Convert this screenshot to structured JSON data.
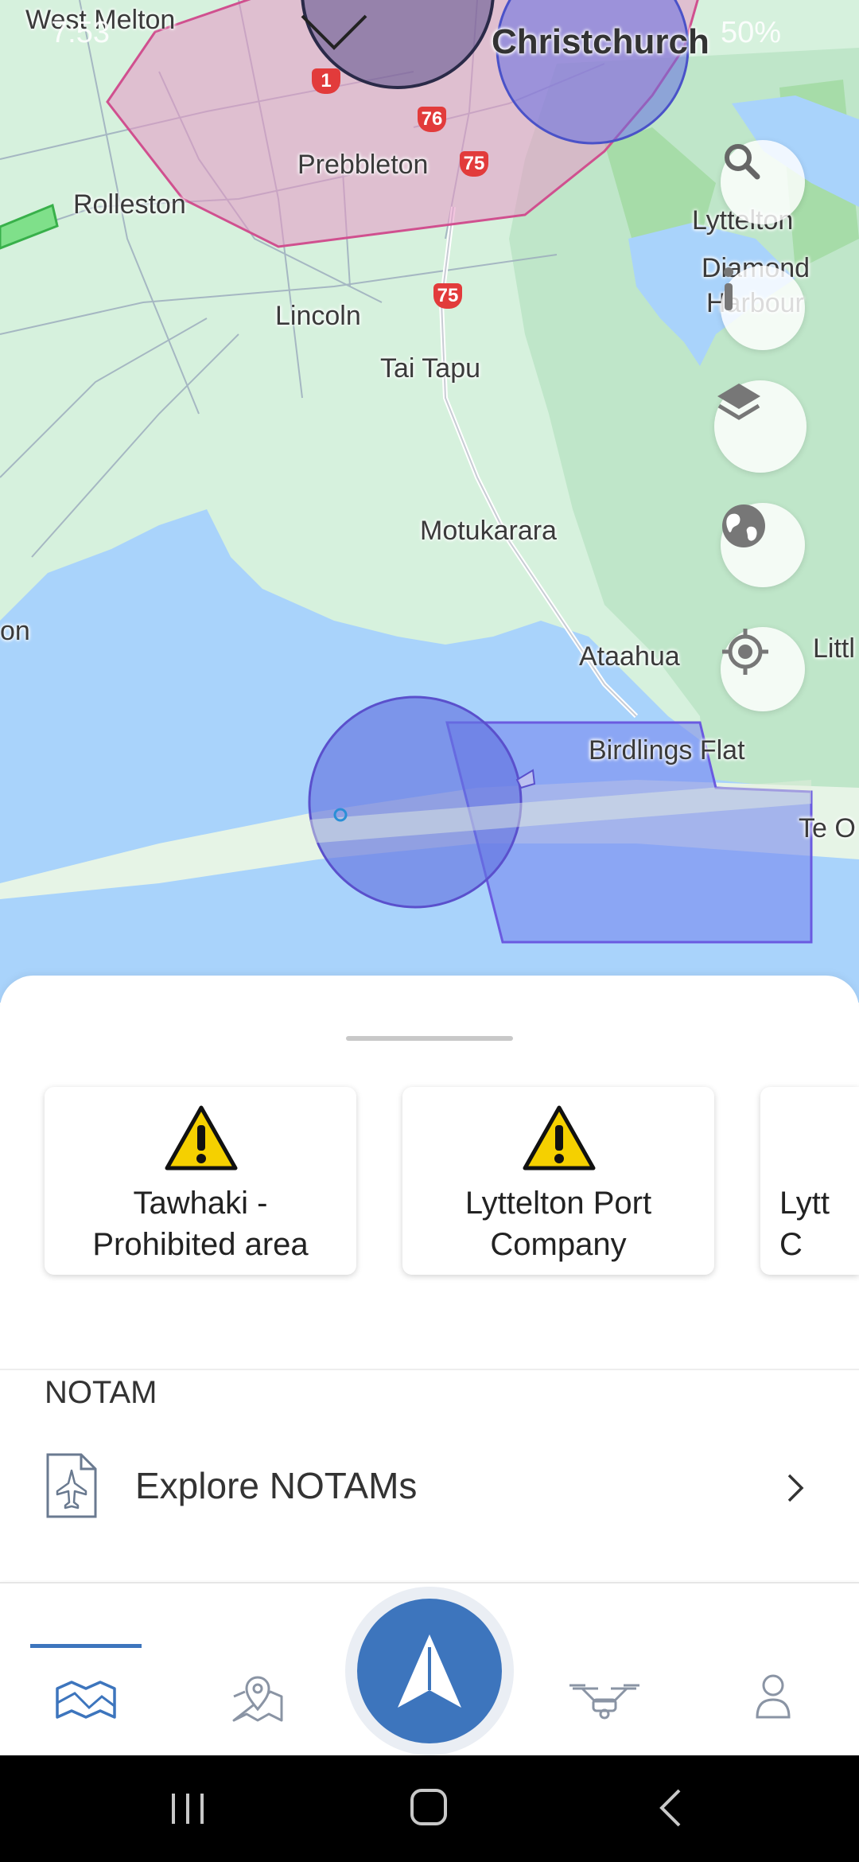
{
  "colors": {
    "land": "#d4f0dc",
    "water": "#a9d3fb",
    "airspace_blue": "#6a78e8",
    "airspace_pink": "#e8a6c8",
    "accent": "#3d75bd"
  },
  "status_bar": {
    "time": "7:53",
    "battery": "50%"
  },
  "map": {
    "place_labels": [
      {
        "name": "West Melton"
      },
      {
        "name": "Christchurch"
      },
      {
        "name": "Prebbleton"
      },
      {
        "name": "Rolleston"
      },
      {
        "name": "Lyttelton"
      },
      {
        "name": "Diamond"
      },
      {
        "name": "Harbour"
      },
      {
        "name": "Lincoln"
      },
      {
        "name": "Tai Tapu"
      },
      {
        "name": "Motukarara"
      },
      {
        "name": "on"
      },
      {
        "name": "Ataahua"
      },
      {
        "name": "Littl"
      },
      {
        "name": "Birdlings Flat"
      },
      {
        "name": "Te O"
      }
    ],
    "route_shields": [
      "1",
      "76",
      "75",
      "75"
    ],
    "controls": [
      "search-icon",
      "info-icon",
      "layers-icon",
      "globe-icon",
      "locate-icon"
    ]
  },
  "advisories": [
    {
      "title": "Tawhaki -\nProhibited area",
      "icon": "warning-icon"
    },
    {
      "title": "Lyttelton Port\nCompany",
      "icon": "warning-icon"
    },
    {
      "title": "Lytt\nC",
      "icon": "warning-icon"
    }
  ],
  "notam": {
    "section_title": "NOTAM",
    "explore_label": "Explore NOTAMs"
  },
  "bottom_nav": {
    "items": [
      "map-icon",
      "places-icon",
      "fly-icon",
      "drone-icon",
      "profile-icon"
    ],
    "active": "map-icon"
  }
}
